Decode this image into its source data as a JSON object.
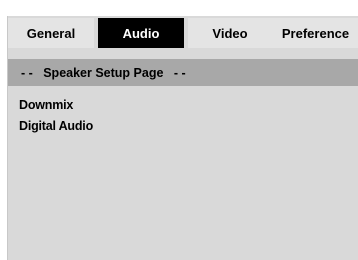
{
  "tabs": [
    {
      "label": "General",
      "active": false
    },
    {
      "label": "Audio",
      "active": true
    },
    {
      "label": "Video",
      "active": false
    },
    {
      "label": "Preference",
      "active": false
    }
  ],
  "page_title": "- -   Speaker Setup Page   - -",
  "menu_items": [
    {
      "label": "Downmix"
    },
    {
      "label": "Digital Audio"
    }
  ],
  "colors": {
    "panel_background": "#d9d9d9",
    "tab_background": "#e4e4e4",
    "active_tab_background": "#000000",
    "active_tab_text": "#ffffff",
    "page_bar_background": "#a8a8a8"
  }
}
